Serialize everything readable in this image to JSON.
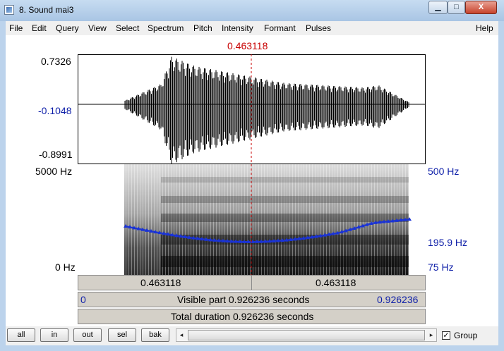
{
  "window": {
    "title": "8. Sound mai3",
    "minimize": "▁",
    "maximize": "□",
    "close": "X"
  },
  "menu": [
    "File",
    "Edit",
    "Query",
    "View",
    "Select",
    "Spectrum",
    "Pitch",
    "Intensity",
    "Formant",
    "Pulses",
    "Help"
  ],
  "editor": {
    "cursor_time": "0.463118",
    "wave_max": "0.7326",
    "wave_zero": "-0.1048",
    "wave_min": "-0.8991",
    "spec_top": "5000 Hz",
    "spec_bottom": "0 Hz",
    "pitch_top": "500 Hz",
    "pitch_cursor": "195.9 Hz",
    "pitch_bottom": "75 Hz",
    "left_segment": "0.463118",
    "right_segment": "0.463118",
    "visible_start": "0",
    "visible_part": "Visible part 0.926236 seconds",
    "visible_end": "0.926236",
    "total_duration": "Total duration 0.926236 seconds"
  },
  "bottom": {
    "buttons": [
      "all",
      "in",
      "out",
      "sel",
      "bak"
    ],
    "scroll_left": "◂",
    "scroll_right": "▸",
    "group_label": "Group",
    "group_checked": "✓"
  },
  "colors": {
    "pitch_line": "#1a33d6",
    "cursor": "#c80000",
    "axis_text": "#0d1ea8"
  }
}
